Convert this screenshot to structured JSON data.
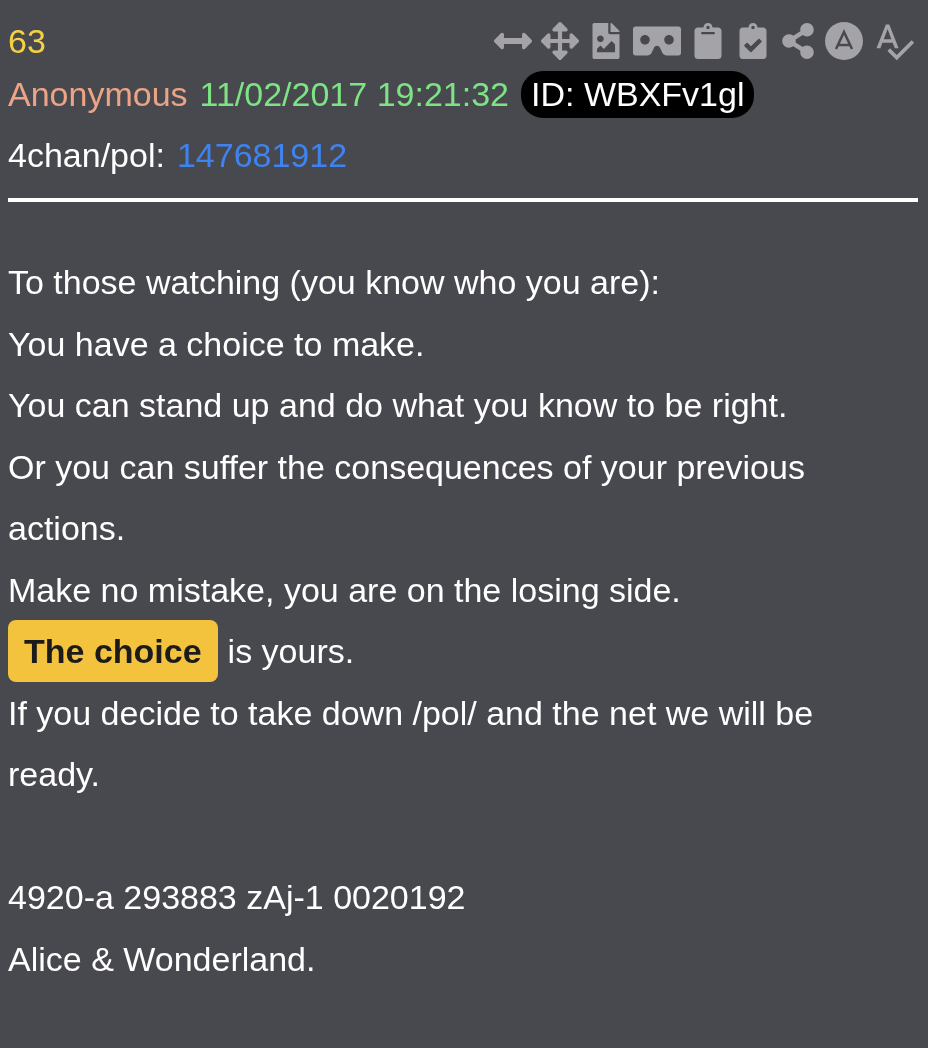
{
  "post": {
    "number": "63",
    "author": "Anonymous",
    "timestamp": "11/02/2017 19:21:32",
    "poster_id": "ID: WBXFv1gl",
    "source_label": "4chan/pol:",
    "source_post": "147681912"
  },
  "body": [
    {
      "kind": "line",
      "segments": [
        {
          "text": "To those watching (you know who you are):",
          "highlighted": false
        }
      ]
    },
    {
      "kind": "line",
      "segments": [
        {
          "text": "You have a choice to make.",
          "highlighted": false
        }
      ]
    },
    {
      "kind": "line",
      "segments": [
        {
          "text": "You can stand up and do what you know to be right.",
          "highlighted": false
        }
      ]
    },
    {
      "kind": "line",
      "segments": [
        {
          "text": "Or you can suffer the consequences of your previous actions.",
          "highlighted": false
        }
      ]
    },
    {
      "kind": "line",
      "segments": [
        {
          "text": "Make no mistake, you are on the losing side.",
          "highlighted": false
        }
      ]
    },
    {
      "kind": "line",
      "segments": [
        {
          "text": "The choice",
          "highlighted": true
        },
        {
          "text": "is yours.",
          "highlighted": false
        }
      ]
    },
    {
      "kind": "line",
      "segments": [
        {
          "text": "If you decide to take down /pol/ and the net we will be ready.",
          "highlighted": false
        }
      ]
    },
    {
      "kind": "gap"
    },
    {
      "kind": "line",
      "segments": [
        {
          "text": "4920-a 293883 zAj-1 0020192",
          "highlighted": false
        }
      ]
    },
    {
      "kind": "line",
      "segments": [
        {
          "text": "Alice & Wonderland.",
          "highlighted": false
        }
      ]
    }
  ]
}
